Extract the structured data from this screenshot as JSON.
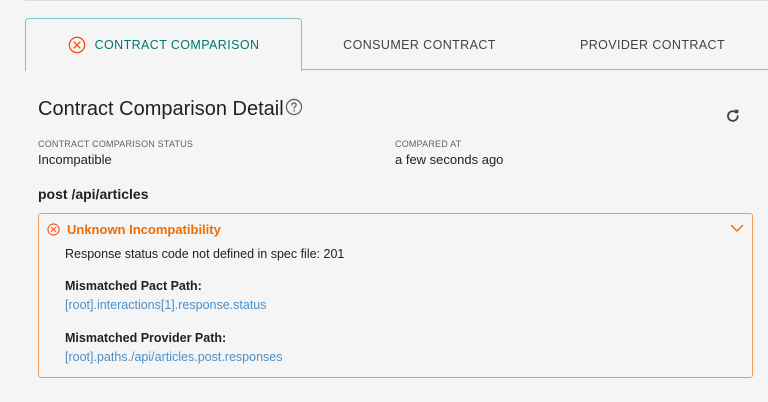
{
  "tabs": {
    "comparison": "CONTRACT COMPARISON",
    "consumer": "CONSUMER CONTRACT",
    "provider": "PROVIDER CONTRACT"
  },
  "header": {
    "title": "Contract Comparison Detail"
  },
  "meta": {
    "status_label": "CONTRACT COMPARISON STATUS",
    "status_value": "Incompatible",
    "compared_label": "COMPARED AT",
    "compared_value": "a few seconds ago"
  },
  "endpoint": "post /api/articles",
  "incompatibility": {
    "title": "Unknown Incompatibility",
    "message": "Response status code not defined in spec file: 201",
    "pact_path_label": "Mismatched Pact Path:",
    "pact_path": "[root].interactions[1].response.status",
    "provider_path_label": "Mismatched Provider Path:",
    "provider_path": "[root].paths./api/articles.post.responses"
  },
  "colors": {
    "accent": "#00796b",
    "tab_border": "#7fc3c3",
    "warning": "#ef6c00",
    "card_border": "#f39a57",
    "link": "#4a90c8"
  },
  "icons": {
    "tab": "error-circle-icon",
    "help": "help-circle-icon",
    "refresh": "refresh-icon",
    "card": "error-circle-icon",
    "collapse": "chevron-down-icon"
  }
}
